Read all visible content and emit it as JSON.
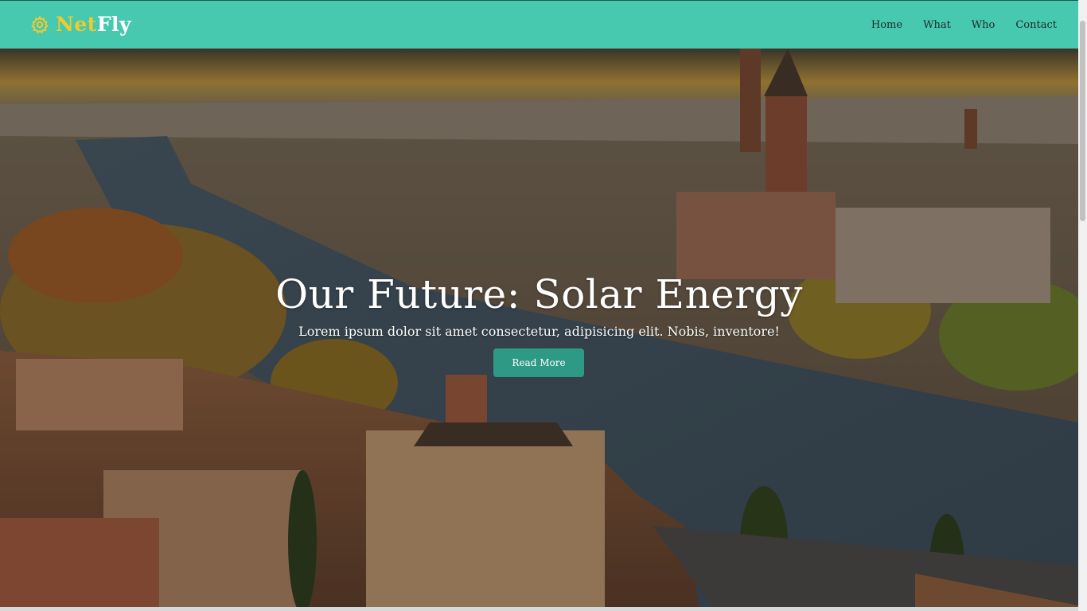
{
  "brand": {
    "part1": "Net",
    "part2": "Fly",
    "icon": "gear-icon"
  },
  "nav": [
    {
      "label": "Home"
    },
    {
      "label": "What"
    },
    {
      "label": "Who"
    },
    {
      "label": "Contact"
    }
  ],
  "hero": {
    "title": "Our Future: Solar Energy",
    "subtitle": "Lorem ipsum dolor sit amet consectetur, adipisicing elit. Nobis, inventore!",
    "button": "Read More"
  },
  "colors": {
    "navbar": "#47c9af",
    "brand_accent": "#f3ca2c",
    "button": "#2e9a86"
  }
}
